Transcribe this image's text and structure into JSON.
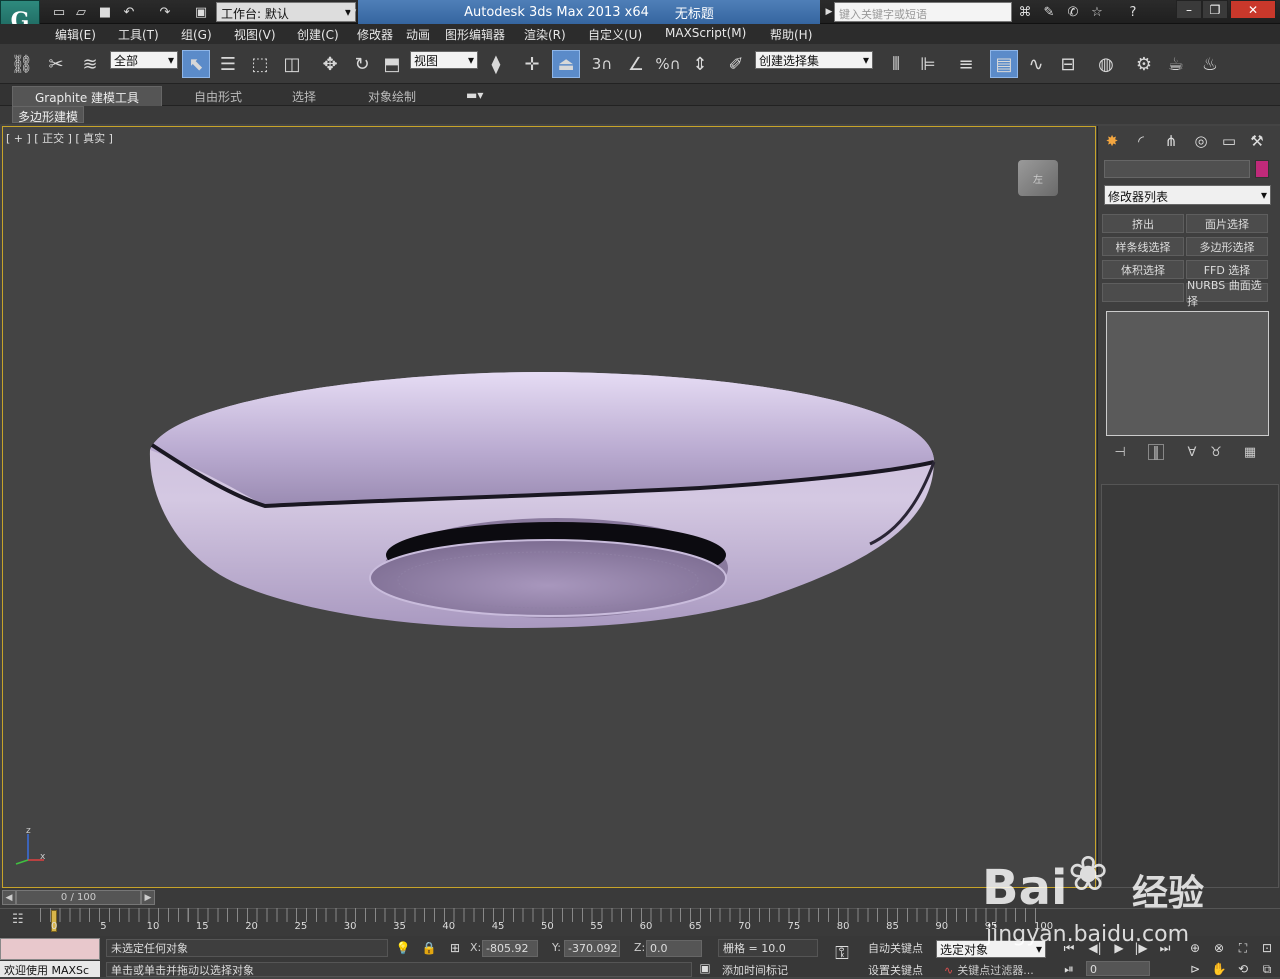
{
  "title": {
    "app_title": "Autodesk 3ds Max  2013 x64",
    "doc_title": "无标题",
    "workspace_label": "工作台: 默认",
    "search_placeholder": "键入关键字或短语"
  },
  "menu": [
    "编辑(E)",
    "工具(T)",
    "组(G)",
    "视图(V)",
    "创建(C)",
    "修改器",
    "动画",
    "图形编辑器",
    "渲染(R)",
    "自定义(U)",
    "MAXScript(M)",
    "帮助(H)"
  ],
  "toolbar": {
    "filter_value": "全部",
    "refcoord_value": "视图",
    "selection_set_value": "创建选择集",
    "snap_label": "3",
    "percent_label": "%"
  },
  "ribbon": {
    "tabs": [
      "Graphite 建模工具",
      "自由形式",
      "选择",
      "对象绘制"
    ],
    "subtab": "多边形建模"
  },
  "viewport": {
    "label": "[ + ] [ 正交 ] [ 真实 ]",
    "viewcube_label": "左",
    "axis_z": "z",
    "axis_x": "x",
    "object_color": "#b8a8cc"
  },
  "panel": {
    "modifier_list": "修改器列表",
    "buttons": [
      "挤出",
      "面片选择",
      "样条线选择",
      "多边形选择",
      "体积选择",
      "FFD 选择",
      "",
      "NURBS 曲面选择"
    ],
    "swatch_color": "#c02a7a"
  },
  "timeline": {
    "slider_label": "0 / 100",
    "ticks": [
      "0",
      "5",
      "10",
      "15",
      "20",
      "25",
      "30",
      "35",
      "40",
      "45",
      "50",
      "55",
      "60",
      "65",
      "70",
      "75",
      "80",
      "85",
      "90",
      "95",
      "100"
    ]
  },
  "status": {
    "maxscript": "欢迎使用 MAXSc",
    "selection": "未选定任何对象",
    "prompt": "单击或单击并拖动以选择对象",
    "x_label": "X:",
    "x_value": "-805.92",
    "y_label": "Y:",
    "y_value": "-370.092",
    "z_label": "Z:",
    "z_value": "0.0",
    "grid": "栅格 = 10.0",
    "add_time_tag": "添加时间标记",
    "auto_key": "自动关键点",
    "set_key": "设置关键点",
    "key_mode": "选定对象",
    "key_filters": "关键点过滤器...",
    "frame": "0"
  },
  "watermark": {
    "brand": "Bai",
    "brand2": "经验",
    "url": "jingyan.baidu.com"
  }
}
